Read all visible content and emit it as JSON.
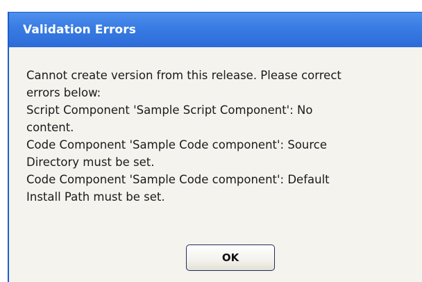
{
  "dialog": {
    "title": "Validation Errors",
    "message_lines": [
      "Cannot create version from this release. Please correct",
      "errors below:",
      "Script Component 'Sample Script Component': No",
      "content.",
      "Code Component 'Sample Code component': Source",
      "Directory must be set.",
      "Code Component 'Sample Code component': Default",
      "Install Path must be set."
    ],
    "ok_label": "OK"
  },
  "colors": {
    "title_bar": "#3a7de4",
    "title_text": "#ffffff",
    "dialog_bg": "#f4f3ee"
  }
}
